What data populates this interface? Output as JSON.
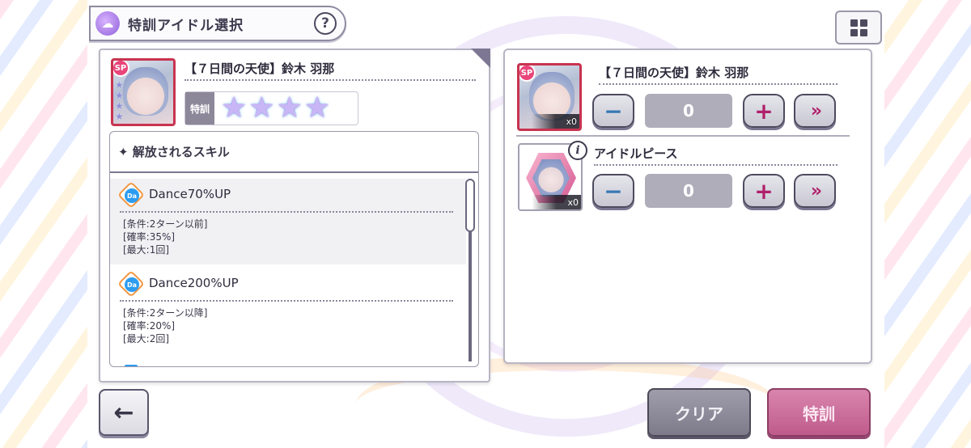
{
  "header": {
    "title": "特訓アイドル選択",
    "help_label": "?"
  },
  "left_panel": {
    "idol_name": "【７日間の天使】鈴木 羽那",
    "card_badge": "SP",
    "training_label": "特訓",
    "training_stars_filled": 4,
    "training_stars_total": 4,
    "skills_header": "✦ 解放されるスキル",
    "skills": [
      {
        "icon_label": "Da",
        "name": "Dance70%UP",
        "conditions": [
          "[条件:2ターン以前]",
          "[確率:35%]",
          "[最大:1回]"
        ]
      },
      {
        "icon_label": "Da",
        "name": "Dance200%UP",
        "conditions": [
          "[条件:2ターン以降]",
          "[確率:20%]",
          "[最大:2回]"
        ]
      }
    ]
  },
  "right_panel": {
    "items": [
      {
        "name": "【７日間の天使】鈴木 羽那",
        "count_label": "x0",
        "badge": "SP",
        "quantity": "0"
      },
      {
        "name": "アイドルピース",
        "count_label": "x0",
        "quantity": "0"
      }
    ],
    "minus_label": "−",
    "plus_label": "+",
    "fast_label": "»"
  },
  "footer": {
    "back_label": "←",
    "clear_label": "クリア",
    "train_label": "特訓"
  },
  "colors": {
    "accent_pink": "#bf5b8c",
    "plus_color": "#b0206a",
    "minus_color": "#3878b4",
    "card_border": "#c8334f"
  }
}
